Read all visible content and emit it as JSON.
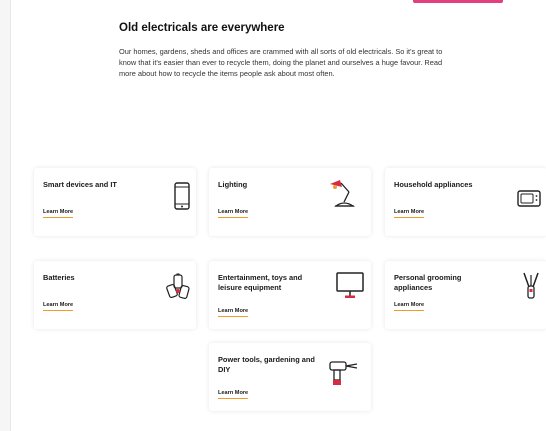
{
  "intro": {
    "heading": "Old electricals are everywhere",
    "body": "Our homes, gardens, sheds and offices are crammed with all sorts of old electricals. So it's great to know that it's easier than ever to recycle them, doing the planet and ourselves a huge favour. Read more about how to recycle the items people ask about most often."
  },
  "colors": {
    "accent": "#e0407f",
    "underline": "#f19a2e",
    "icon_red": "#d62b45"
  },
  "categories": [
    {
      "title": "Smart devices and IT",
      "link": "Learn More",
      "icon": "smartphone-icon"
    },
    {
      "title": "Lighting",
      "link": "Learn More",
      "icon": "desk-lamp-icon"
    },
    {
      "title": "Household appliances",
      "link": "Learn More",
      "icon": "microwave-icon"
    },
    {
      "title": "Batteries",
      "link": "Learn More",
      "icon": "batteries-icon"
    },
    {
      "title": "Entertainment, toys and leisure equipment",
      "link": "Learn More",
      "icon": "monitor-icon"
    },
    {
      "title": "Personal grooming appliances",
      "link": "Learn More",
      "icon": "hair-clipper-icon"
    },
    {
      "title": "Power tools, gardening and DIY",
      "link": "Learn More",
      "icon": "power-drill-icon"
    }
  ]
}
